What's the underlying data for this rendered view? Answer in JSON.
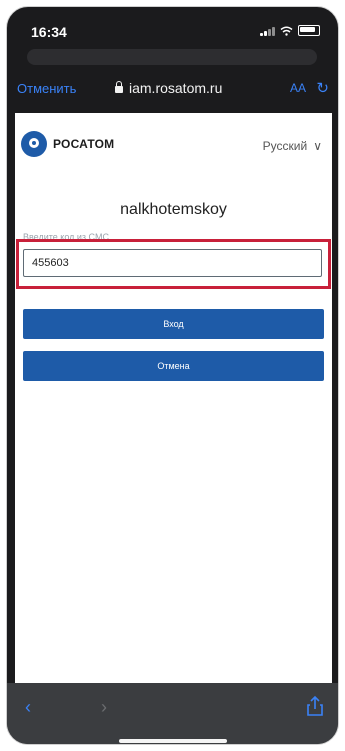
{
  "status": {
    "time": "16:34"
  },
  "navbar": {
    "cancel_label": "Отменить",
    "url": "iam.rosatom.ru",
    "aa_label": "AA",
    "reload_glyph": "↻"
  },
  "page": {
    "logo_text": "РОСАТОМ",
    "language": "Русский",
    "language_chevron": "∨",
    "username": "nalkhotemskoy",
    "field_label": "Введите код из СМС",
    "code_value": "455603",
    "login_label": "Вход",
    "cancel_label": "Отмена"
  },
  "toolbar": {
    "back_glyph": "‹",
    "forward_glyph": "›"
  },
  "colors": {
    "accent": "#1e5ba8",
    "highlight": "#c8203a",
    "link": "#3a82f7"
  }
}
